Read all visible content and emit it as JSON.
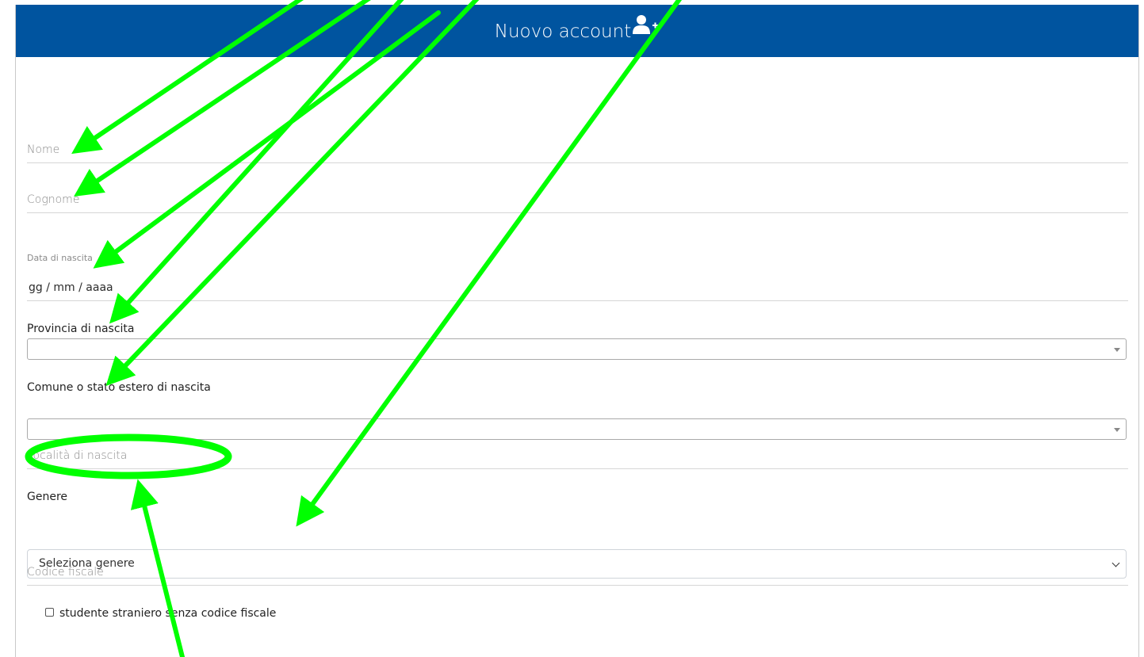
{
  "header": {
    "title": "Nuovo account",
    "icon": "user-plus-icon",
    "bg_color": "#00549f"
  },
  "form": {
    "nome_placeholder": "Nome",
    "cognome_placeholder": "Cognome",
    "data_label": "Data di nascita",
    "data_value": "gg / mm / aaaa",
    "provincia_label": "Provincia di nascita",
    "provincia_value": "",
    "comune_label": "Comune o stato estero di nascita",
    "comune_value": "",
    "localita_placeholder": "Località di nascita",
    "genere_label": "Genere",
    "genere_value": "Seleziona genere",
    "codice_placeholder": "Codice fiscale",
    "checkbox_label": "studente straniero senza codice fiscale",
    "checkbox_checked": false
  },
  "annotations": {
    "arrow_color": "#00ff00",
    "highlighted_field": "Località di nascita"
  }
}
